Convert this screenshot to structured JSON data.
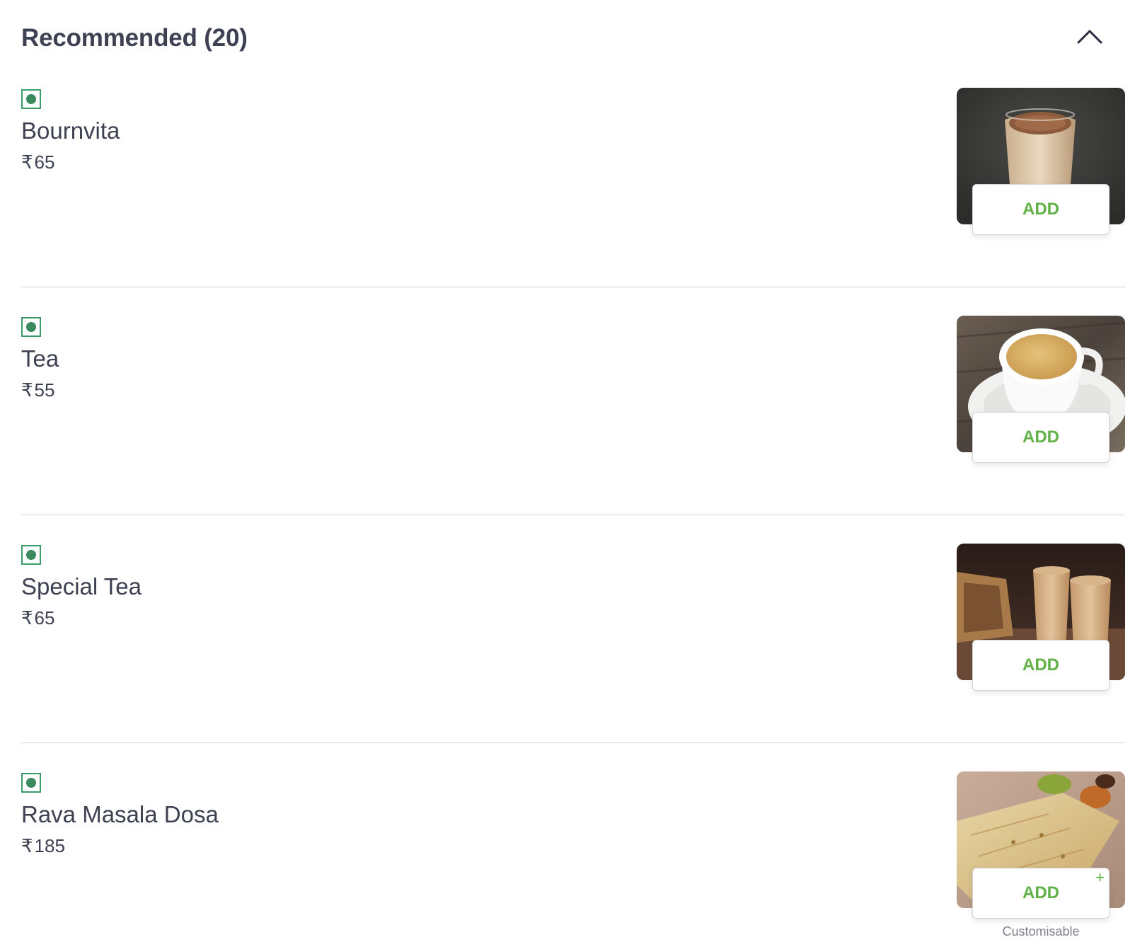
{
  "section": {
    "title": "Recommended (20)",
    "collapse_icon": "chevron-up-icon"
  },
  "colors": {
    "veg": "#3a9b6b",
    "add_text": "#60b246",
    "text": "#3d4152",
    "divider": "#d4d5d9"
  },
  "items": [
    {
      "name": "Bournvita",
      "currency": "₹",
      "price": "65",
      "button": "ADD",
      "veg_icon": "veg-indicator-icon",
      "image": "bournvita-glass-photo"
    },
    {
      "name": "Tea",
      "currency": "₹",
      "price": "55",
      "button": "ADD",
      "veg_icon": "veg-indicator-icon",
      "image": "tea-cup-photo"
    },
    {
      "name": "Special Tea",
      "currency": "₹",
      "price": "65",
      "button": "ADD",
      "veg_icon": "veg-indicator-icon",
      "image": "special-tea-glasses-photo"
    },
    {
      "name": "Rava Masala Dosa",
      "currency": "₹",
      "price": "185",
      "button": "ADD",
      "button_plus": "+",
      "customisable": "Customisable",
      "veg_icon": "veg-indicator-icon",
      "image": "rava-masala-dosa-photo"
    }
  ]
}
